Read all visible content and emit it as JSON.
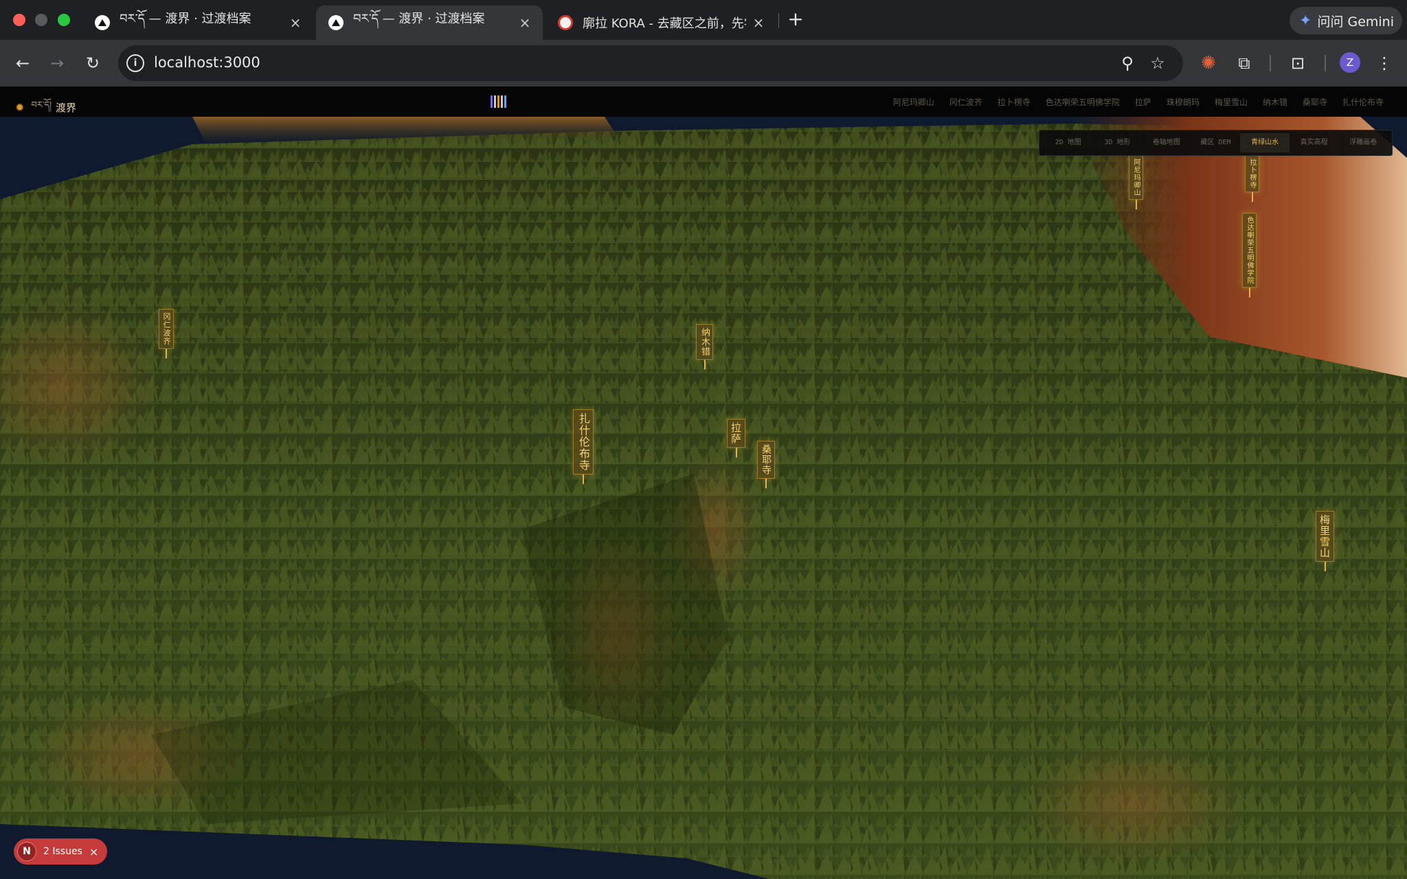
{
  "browser": {
    "tabs": [
      {
        "title": "བར་དོ — 渡界 · 过渡档案",
        "active": false
      },
      {
        "title": "བར་དོ — 渡界 · 过渡档案",
        "active": true
      },
      {
        "title": "廓拉 KORA - 去藏区之前，先学",
        "active": false
      }
    ],
    "new_tab_label": "+",
    "close_glyph": "×",
    "gemini_label": "问问 Gemini",
    "url": "localhost:3000",
    "avatar_initial": "Z"
  },
  "app": {
    "brand_tibetan": "བར་དོ།",
    "brand_chinese": "渡界",
    "barcode_colors": [
      "#7b6cd8",
      "#c8c8c8",
      "#d99a2b",
      "#c8c8c8",
      "#6fa2d8"
    ],
    "nav": [
      "阿尼玛卿山",
      "冈仁波齐",
      "拉卜楞寺",
      "色达喇荣五明佛学院",
      "拉萨",
      "珠穆朗玛",
      "梅里雪山",
      "纳木错",
      "桑耶寺",
      "扎什伦布寺"
    ],
    "modes": [
      {
        "label": "2D 地图",
        "active": false
      },
      {
        "label": "3D 地形",
        "active": false
      },
      {
        "label": "卷轴地图",
        "active": false
      },
      {
        "label": "藏区 DEM",
        "active": false
      },
      {
        "label": "青绿山水",
        "active": true
      },
      {
        "label": "真实高程",
        "active": false
      },
      {
        "label": "浮雕画卷",
        "active": false
      }
    ],
    "markers": [
      {
        "name": "冈仁波齐"
      },
      {
        "name": "纳木错"
      },
      {
        "name": "扎什伦布寺"
      },
      {
        "name": "拉萨"
      },
      {
        "name": "桑耶寺"
      },
      {
        "name": "梅里雪山"
      },
      {
        "name": "阿尼玛卿山"
      },
      {
        "name": "拉卜楞寺"
      },
      {
        "name": "色达喇荣五明佛学院"
      }
    ]
  },
  "devtools": {
    "issues_badge": "N",
    "issues_label": "2 Issues",
    "dismiss": "×"
  },
  "colors": {
    "accent_gold": "#e1b04f",
    "terrain_green": "#3b4a1c",
    "sky_navy": "#0f1a2e",
    "issues_red": "#c53b3b"
  }
}
